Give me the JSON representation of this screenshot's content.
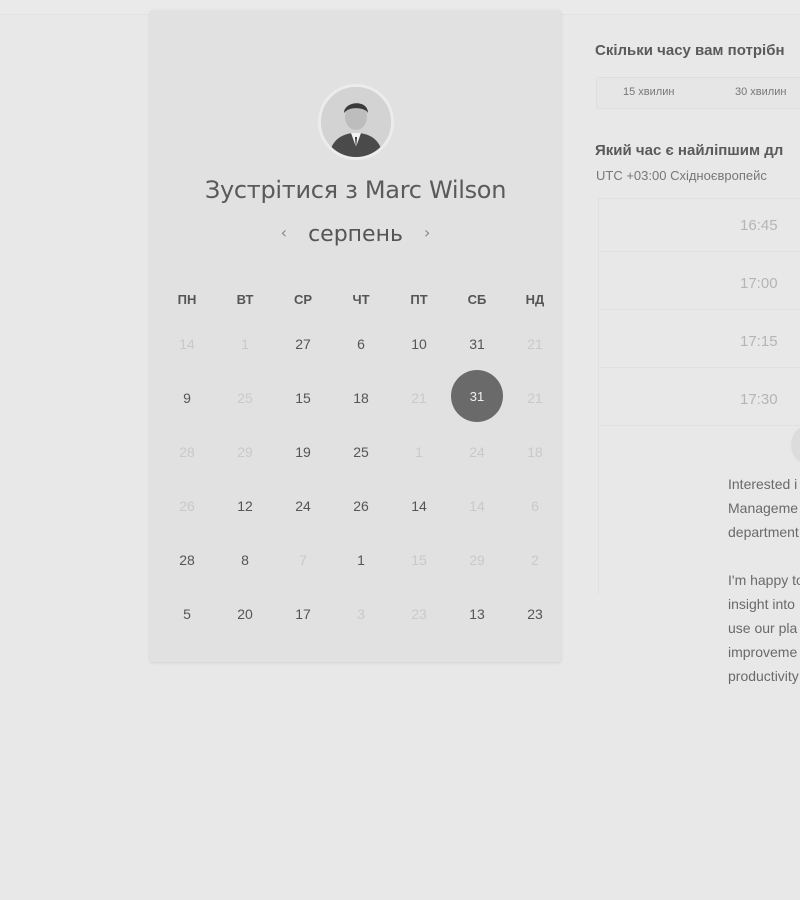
{
  "calendar": {
    "title": "Зустрітися з Marc Wilson",
    "month": "серпень",
    "prev_icon": "‹",
    "next_icon": "›",
    "weekdays": [
      "ПН",
      "ВТ",
      "СР",
      "ЧТ",
      "ПТ",
      "СБ",
      "НД"
    ],
    "weeks": [
      [
        {
          "d": "14",
          "m": true
        },
        {
          "d": "1",
          "m": true
        },
        {
          "d": "27",
          "m": false
        },
        {
          "d": "6",
          "m": false
        },
        {
          "d": "10",
          "m": false
        },
        {
          "d": "31",
          "m": false
        },
        {
          "d": "21",
          "m": true
        }
      ],
      [
        {
          "d": "9",
          "m": false
        },
        {
          "d": "25",
          "m": true
        },
        {
          "d": "15",
          "m": false
        },
        {
          "d": "18",
          "m": false
        },
        {
          "d": "21",
          "m": true
        },
        {
          "d": "31",
          "m": false,
          "sel": true
        },
        {
          "d": "21",
          "m": true
        }
      ],
      [
        {
          "d": "28",
          "m": true
        },
        {
          "d": "29",
          "m": true
        },
        {
          "d": "19",
          "m": false
        },
        {
          "d": "25",
          "m": false
        },
        {
          "d": "1",
          "m": true
        },
        {
          "d": "24",
          "m": true
        },
        {
          "d": "18",
          "m": true
        }
      ],
      [
        {
          "d": "26",
          "m": true
        },
        {
          "d": "12",
          "m": false
        },
        {
          "d": "24",
          "m": false
        },
        {
          "d": "26",
          "m": false
        },
        {
          "d": "14",
          "m": false
        },
        {
          "d": "14",
          "m": true
        },
        {
          "d": "6",
          "m": true
        }
      ],
      [
        {
          "d": "28",
          "m": false
        },
        {
          "d": "8",
          "m": false
        },
        {
          "d": "7",
          "m": true
        },
        {
          "d": "1",
          "m": false
        },
        {
          "d": "15",
          "m": true
        },
        {
          "d": "29",
          "m": true
        },
        {
          "d": "2",
          "m": true
        }
      ],
      [
        {
          "d": "5",
          "m": false
        },
        {
          "d": "20",
          "m": false
        },
        {
          "d": "17",
          "m": false
        },
        {
          "d": "3",
          "m": true
        },
        {
          "d": "23",
          "m": true
        },
        {
          "d": "13",
          "m": false
        },
        {
          "d": "23",
          "m": false
        }
      ]
    ]
  },
  "duration": {
    "question": "Скільки часу вам потрібн",
    "options": [
      "15 хвилин",
      "30 хвилин"
    ]
  },
  "time": {
    "question": "Який час є найліпшим дл",
    "timezone": "UTC +03:00 Східноєвропейс",
    "slots": [
      "16:45",
      "17:00",
      "17:15",
      "17:30"
    ]
  },
  "description": {
    "para1": [
      "Interested i",
      "Manageme",
      "department"
    ],
    "para2": [
      "I'm happy to",
      "insight into",
      "use our pla",
      "improveme",
      "productivity"
    ]
  }
}
